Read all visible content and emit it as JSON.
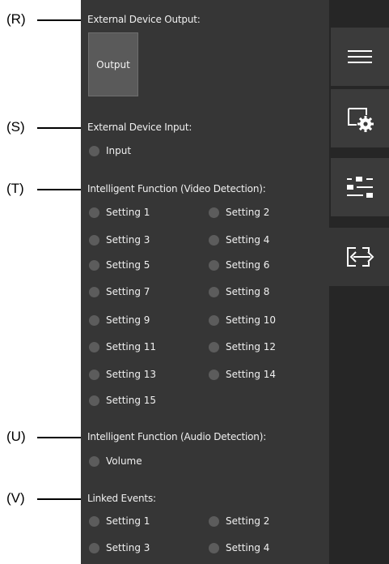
{
  "callouts": [
    "(R)",
    "(S)",
    "(T)",
    "(U)",
    "(V)"
  ],
  "external_output": {
    "title": "External Device Output:",
    "button_label": "Output"
  },
  "external_input": {
    "title": "External Device Input:",
    "items": [
      "Input"
    ]
  },
  "video_detection": {
    "title": "Intelligent Function (Video Detection):",
    "items": [
      "Setting 1",
      "Setting 2",
      "Setting 3",
      "Setting 4",
      "Setting 5",
      "Setting 6",
      "Setting 7",
      "Setting 8",
      "Setting 9",
      "Setting 10",
      "Setting 11",
      "Setting 12",
      "Setting 13",
      "Setting 14",
      "Setting 15"
    ]
  },
  "audio_detection": {
    "title": "Intelligent Function (Audio Detection):",
    "items": [
      "Volume"
    ]
  },
  "linked_events": {
    "title": "Linked Events:",
    "items": [
      "Setting 1",
      "Setting 2",
      "Setting 3",
      "Setting 4"
    ]
  },
  "sidebar": {
    "buttons": [
      {
        "icon": "hamburger-menu-icon",
        "active": false
      },
      {
        "icon": "screen-settings-icon",
        "active": false
      },
      {
        "icon": "sliders-icon",
        "active": false
      },
      {
        "icon": "input-output-arrows-icon",
        "active": true
      }
    ]
  },
  "colors": {
    "panel_bg": "#363636",
    "sidebar_bg": "#262626",
    "indicator_off": "#5c5c5c"
  }
}
